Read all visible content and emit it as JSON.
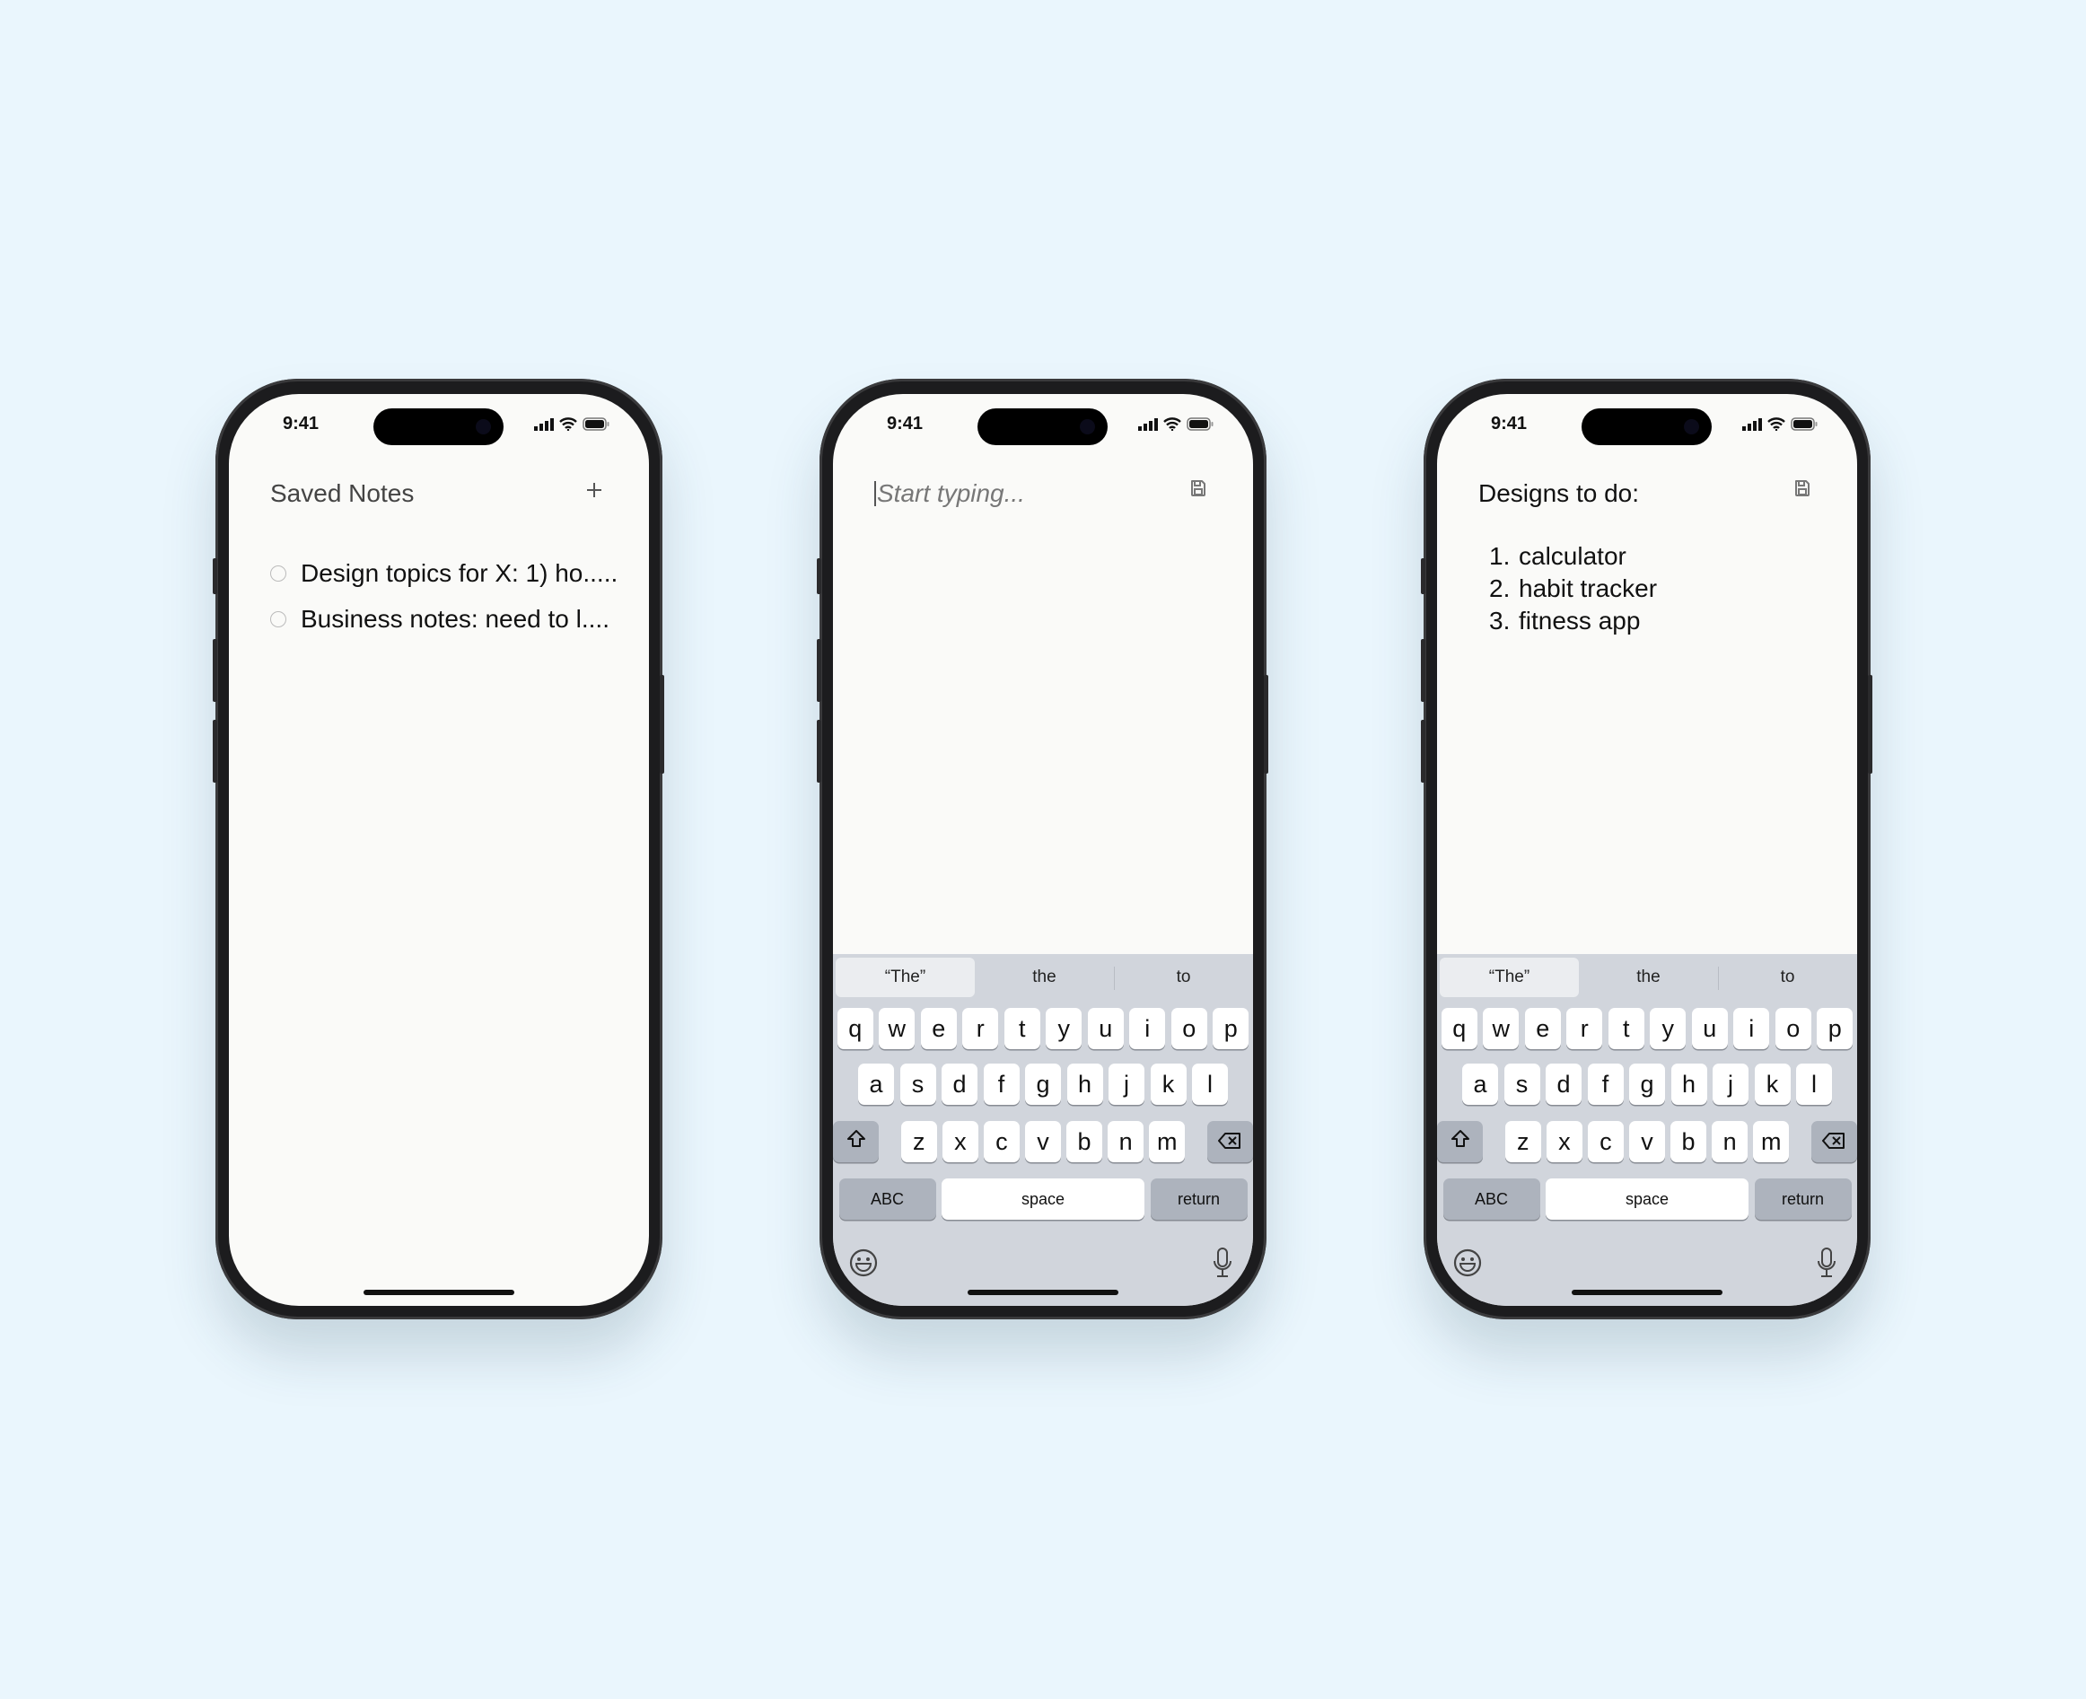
{
  "colors": {
    "background": "#eaf6fd",
    "screen": "#fafaf8",
    "keyboard": "#d1d5dc",
    "special_key": "#adb3bd"
  },
  "status": {
    "time": "9:41"
  },
  "phone1": {
    "title": "Saved Notes",
    "add_icon": "plus-icon",
    "notes": [
      "Design topics for X: 1) ho.....",
      "Business notes: need to l...."
    ]
  },
  "phone2": {
    "placeholder": "Start typing...",
    "save_icon": "floppy-disk-icon"
  },
  "phone3": {
    "title": "Designs to do:",
    "save_icon": "floppy-disk-icon",
    "list": [
      {
        "num": "1.",
        "text": "calculator"
      },
      {
        "num": "2.",
        "text": "habit tracker"
      },
      {
        "num": "3.",
        "text": "fitness app"
      }
    ]
  },
  "keyboard": {
    "suggestions": [
      "“The”",
      "the",
      "to"
    ],
    "rows": [
      [
        "q",
        "w",
        "e",
        "r",
        "t",
        "y",
        "u",
        "i",
        "o",
        "p"
      ],
      [
        "a",
        "s",
        "d",
        "f",
        "g",
        "h",
        "j",
        "k",
        "l"
      ],
      [
        "z",
        "x",
        "c",
        "v",
        "b",
        "n",
        "m"
      ]
    ],
    "abc": "ABC",
    "space": "space",
    "return": "return",
    "icons": [
      "shift-icon",
      "backspace-icon",
      "emoji-icon",
      "microphone-icon"
    ]
  }
}
